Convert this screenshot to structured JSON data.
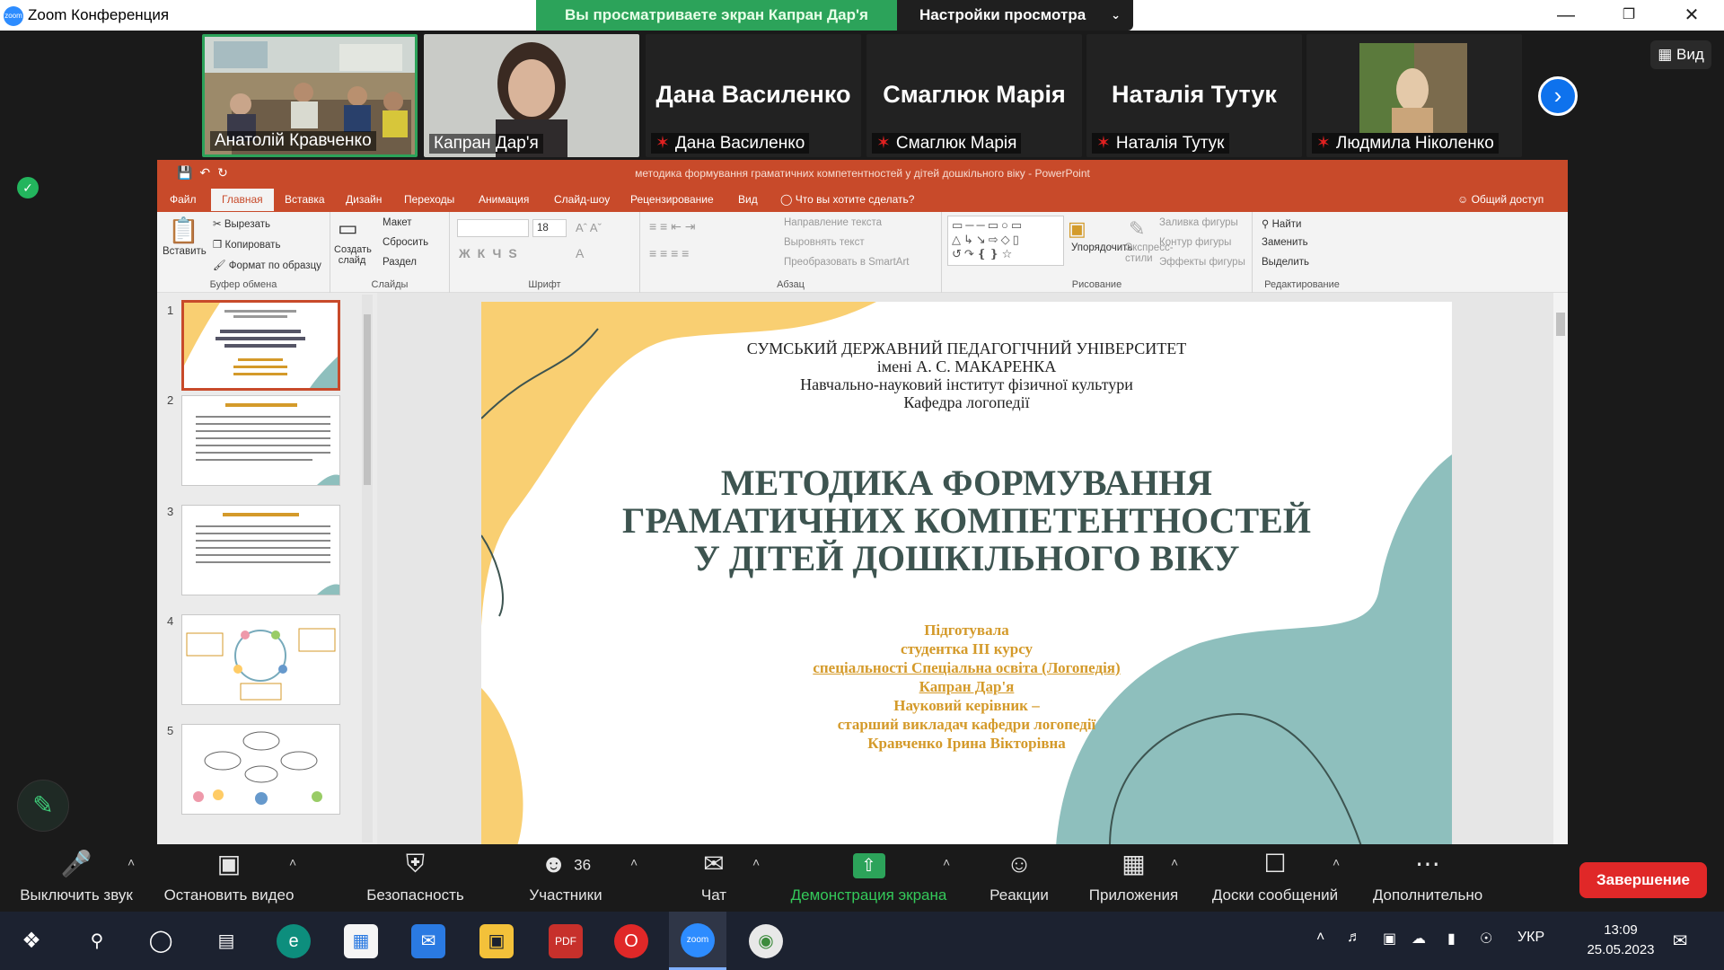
{
  "zoom": {
    "window_title": "Zoom Конференция",
    "logo_text": "zoom",
    "banner_viewing": "Вы просматриваете экран Капран Дар'я",
    "banner_options": "Настройки просмотра",
    "view_button": "Вид",
    "participants": [
      {
        "name": "Анатолій Кравченко",
        "muted": false,
        "video": true
      },
      {
        "name": "Капран Дар'я",
        "muted": false,
        "video": true
      },
      {
        "name": "Дана Василенко",
        "muted": true,
        "video": false
      },
      {
        "name": "Смаглюк Марія",
        "muted": true,
        "video": false
      },
      {
        "name": "Наталія Тутук",
        "muted": true,
        "video": false
      },
      {
        "name": "Людмила Ніколенко",
        "muted": true,
        "video": true
      }
    ],
    "controls": {
      "mute": "Выключить звук",
      "video": "Остановить видео",
      "security": "Безопасность",
      "participants": "Участники",
      "participants_count": "36",
      "chat": "Чат",
      "share": "Демонстрация экрана",
      "reactions": "Реакции",
      "apps": "Приложения",
      "whiteboards": "Доски сообщений",
      "more": "Дополнительно",
      "end": "Завершение"
    }
  },
  "ppt": {
    "title": "методика формування граматичних компетентностей у дітей дошкільного віку - PowerPoint",
    "tabs": [
      "Файл",
      "Главная",
      "Вставка",
      "Дизайн",
      "Переходы",
      "Анимация",
      "Слайд-шоу",
      "Рецензирование",
      "Вид"
    ],
    "active_tab": "Главная",
    "tell_me": "Что вы хотите сделать?",
    "share": "Общий доступ",
    "ribbon": {
      "paste": "Вставить",
      "cut": "Вырезать",
      "copy": "Копировать",
      "format_painter": "Формат по образцу",
      "clipboard_group": "Буфер обмена",
      "new_slide": "Создать слайд",
      "layout": "Макет",
      "reset": "Сбросить",
      "section": "Раздел",
      "slides_group": "Слайды",
      "font_size": "18",
      "font_group": "Шрифт",
      "text_direction": "Направление текста",
      "align_text": "Выровнять текст",
      "smartart": "Преобразовать в SmartArt",
      "paragraph_group": "Абзац",
      "arrange": "Упорядочить",
      "quick_styles": "Экспресс-стили",
      "shape_fill": "Заливка фигуры",
      "shape_outline": "Контур фигуры",
      "shape_effects": "Эффекты фигуры",
      "drawing_group": "Рисование",
      "find": "Найти",
      "replace": "Заменить",
      "select": "Выделить",
      "editing_group": "Редактирование"
    },
    "thumbnails": [
      "1",
      "2",
      "3",
      "4",
      "5"
    ],
    "slide": {
      "university": "СУМСЬКИЙ ДЕРЖАВНИЙ ПЕДАГОГІЧНИЙ УНІВЕРСИТЕТ",
      "named": "імені А. С. МАКАРЕНКА",
      "institute": "Навчально-науковий інститут фізичної культури",
      "department": "Кафедра логопедії",
      "title_line1": "МЕТОДИКА ФОРМУВАННЯ",
      "title_line2": "ГРАМАТИЧНИХ КОМПЕТЕНТНОСТЕЙ",
      "title_line3": "У ДІТЕЙ ДОШКІЛЬНОГО ВІКУ",
      "prepared": "Підготувала",
      "student": "студентка ІІІ курсу",
      "specialty": "спеціальності Спеціальна освіта (Логопедія)",
      "author": "Капран Дар'я",
      "supervisor": "Науковий керівник –",
      "position": "старший викладач кафедри логопедії",
      "supervisor_name": "Кравченко Ірина Вікторівна",
      "colors": {
        "title": "#3d5450",
        "accent": "#d49a2a",
        "yellow": "#f9cf72",
        "teal": "#8ebfbd"
      }
    }
  },
  "taskbar": {
    "lang": "УКР",
    "time": "13:09",
    "date": "25.05.2023"
  }
}
